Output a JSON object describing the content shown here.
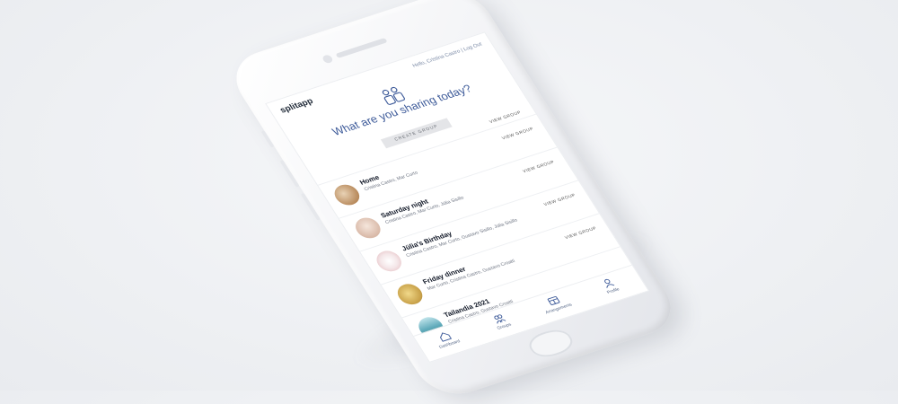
{
  "app": {
    "brand": "splitapp",
    "user_line": "Hello, Cristina Castro | Log Out"
  },
  "hero": {
    "icon": "people-group-icon",
    "title": "What are you sharing today?",
    "create_button": "CREATE GROUP"
  },
  "groups": [
    {
      "name": "Home",
      "members": "Cristina Castro, Mar Curto",
      "view": "VIEW GROUP",
      "avatar_color": "#b88a5c"
    },
    {
      "name": "Saturday night",
      "members": "Cristina Castro, Mar Curto, Jülia Sisillo",
      "view": "VIEW GROUP",
      "avatar_color": "#d9b9a8"
    },
    {
      "name": "Jülia's Birthday",
      "members": "Cristina Castro, Mar Curto, Gustavo Sisillo, Jülia Sisillo",
      "view": "VIEW GROUP",
      "avatar_color": "#e9c9cc"
    },
    {
      "name": "Friday dinner",
      "members": "Mar Curto, Cristina Castro, Gustavo Croatti",
      "view": "VIEW GROUP",
      "avatar_color": "#c9a24a"
    },
    {
      "name": "Tailandia 2021",
      "members": "Cristina Castro, Gustavo Croatti",
      "view": "VIEW GROUP",
      "avatar_color": "#5aa7b8"
    }
  ],
  "tabbar": [
    {
      "label": "Dashboard",
      "icon": "home-icon"
    },
    {
      "label": "Groups",
      "icon": "group-icon"
    },
    {
      "label": "Arrangements",
      "icon": "arrangement-icon"
    },
    {
      "label": "Profile",
      "icon": "user-icon"
    }
  ]
}
